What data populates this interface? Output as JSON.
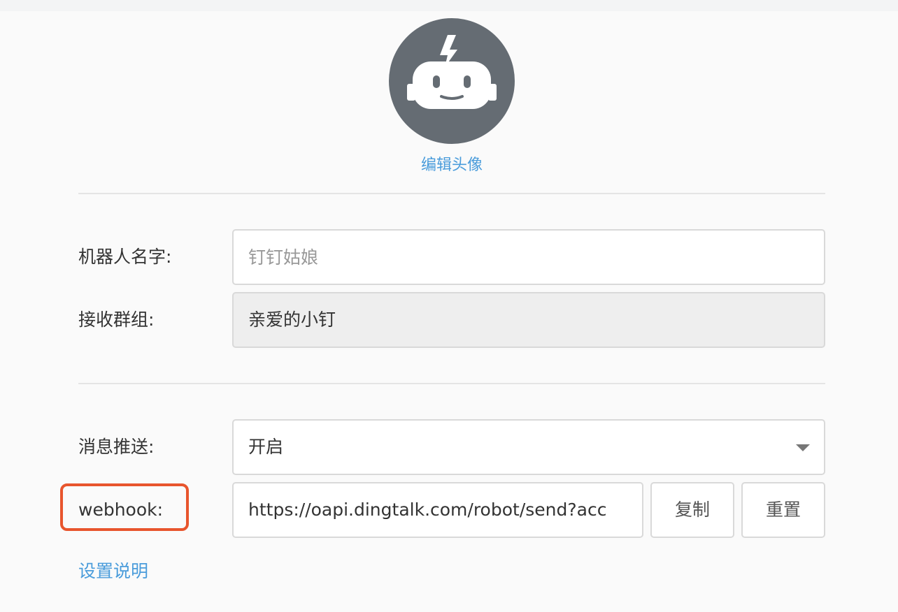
{
  "avatar": {
    "icon": "robot-icon",
    "background_color": "#656c73",
    "edit_label": "编辑头像"
  },
  "form": {
    "robot_name": {
      "label": "机器人名字:",
      "placeholder": "钉钉姑娘",
      "value": ""
    },
    "receive_group": {
      "label": "接收群组:",
      "value": "亲爱的小钉"
    },
    "message_push": {
      "label": "消息推送:",
      "selected": "开启"
    },
    "webhook": {
      "label": "webhook:",
      "value": "https://oapi.dingtalk.com/robot/send?acc",
      "copy_label": "复制",
      "reset_label": "重置"
    }
  },
  "help_link": "设置说明",
  "colors": {
    "link": "#4a9cdb",
    "highlight": "#e8552d"
  }
}
